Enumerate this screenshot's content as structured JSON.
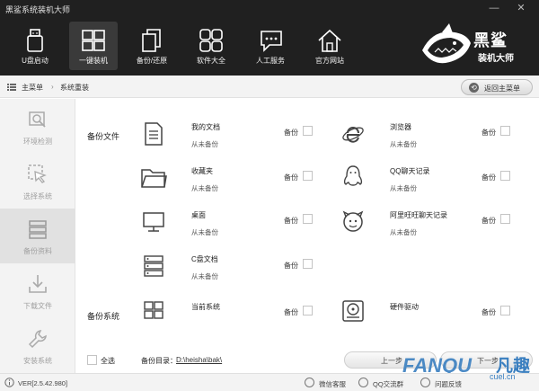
{
  "window": {
    "title": "黑鲨系统装机大师",
    "min_glyph": "—",
    "close_glyph": "✕"
  },
  "toolbar": {
    "items": [
      {
        "label": "U盘启动",
        "icon": "usb-drive-icon"
      },
      {
        "label": "一键装机",
        "icon": "windows-logo-icon",
        "active": true
      },
      {
        "label": "备份/还原",
        "icon": "copy-icon"
      },
      {
        "label": "软件大全",
        "icon": "apps-grid-icon"
      },
      {
        "label": "人工服务",
        "icon": "chat-bubble-icon"
      },
      {
        "label": "官方网站",
        "icon": "home-icon"
      }
    ]
  },
  "brand": {
    "line1": "黑鲨",
    "line2": "装机大师"
  },
  "breadcrumb": {
    "root": "主菜单",
    "current": "系统重装",
    "back_button": "返回主菜单"
  },
  "sidebar": {
    "items": [
      {
        "label": "环境检测",
        "icon": "environment-check-icon"
      },
      {
        "label": "选择系统",
        "icon": "cursor-select-icon"
      },
      {
        "label": "备份资料",
        "icon": "backup-data-icon",
        "active": true
      },
      {
        "label": "下载文件",
        "icon": "download-icon"
      },
      {
        "label": "安装系统",
        "icon": "wrench-icon"
      }
    ]
  },
  "main": {
    "section_files": "备份文件",
    "section_system": "备份系统",
    "backup_label": "备份",
    "items_left": [
      {
        "name": "我的文档",
        "status": "从未备份",
        "icon": "document-icon"
      },
      {
        "name": "收藏夹",
        "status": "从未备份",
        "icon": "folder-icon"
      },
      {
        "name": "桌面",
        "status": "从未备份",
        "icon": "monitor-icon"
      },
      {
        "name": "C盘文档",
        "status": "从未备份",
        "icon": "server-rack-icon"
      }
    ],
    "items_right": [
      {
        "name": "浏览器",
        "status": "从未备份",
        "icon": "browser-ie-icon"
      },
      {
        "name": "QQ聊天记录",
        "status": "从未备份",
        "icon": "qq-penguin-icon"
      },
      {
        "name": "阿里旺旺聊天记录",
        "status": "从未备份",
        "icon": "wangwang-icon"
      }
    ],
    "system_left": {
      "name": "当前系统",
      "icon": "windows-small-icon"
    },
    "system_right": {
      "name": "硬件驱动",
      "icon": "hard-disk-icon"
    },
    "select_all": "全选",
    "dir_label": "备份目录：",
    "dir_value": "D:\\heisha\\bak\\",
    "prev_button": "上一步",
    "next_button": "下一步"
  },
  "statusbar": {
    "version": "VER[2.5.42.980]",
    "wechat": "微信客服",
    "qq": "QQ交流群",
    "feedback": "问题反馈"
  },
  "watermark": {
    "text1": "FANQU",
    "text2": "凡趣",
    "text3": "cuel.cn"
  }
}
